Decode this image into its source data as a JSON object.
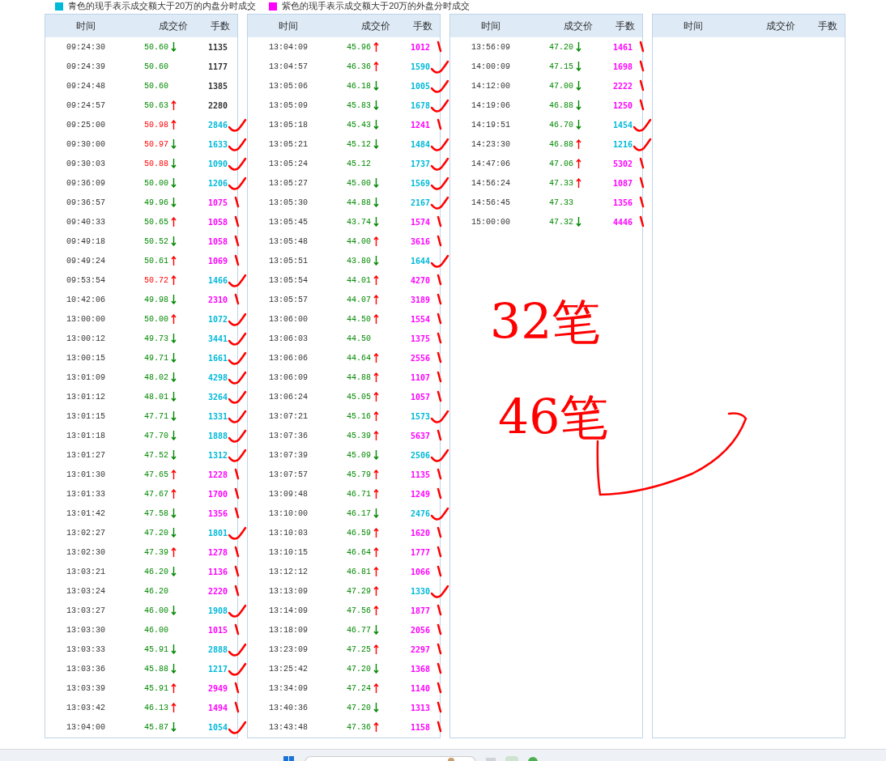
{
  "legend": [
    {
      "color": "#00b9d9",
      "text": "青色的现手表示成交额大于20万的内盘分时成交"
    },
    {
      "color": "#ff00ff",
      "text": "紫色的现手表示成交额大于20万的外盘分时成交"
    }
  ],
  "tables": [
    {
      "columns": [
        "时间",
        "成交价",
        "手数"
      ],
      "rows": [
        {
          "time": "09:24:30",
          "price": "50.60",
          "price_up": false,
          "kind": "down",
          "volume": "1135",
          "color": "#333333"
        },
        {
          "time": "09:24:39",
          "price": "50.60",
          "price_up": false,
          "kind": "none",
          "volume": "1177",
          "color": "#333333"
        },
        {
          "time": "09:24:48",
          "price": "50.60",
          "price_up": false,
          "kind": "none",
          "volume": "1385",
          "color": "#333333"
        },
        {
          "time": "09:24:57",
          "price": "50.63",
          "price_up": false,
          "kind": "up",
          "volume": "2280",
          "color": "#333333"
        },
        {
          "time": "09:25:00",
          "price": "50.98",
          "price_up": true,
          "kind": "up",
          "volume": "2846",
          "color": "#00b9d9"
        },
        {
          "time": "09:30:00",
          "price": "50.97",
          "price_up": true,
          "kind": "down",
          "volume": "1633",
          "color": "#00b9d9"
        },
        {
          "time": "09:30:03",
          "price": "50.88",
          "price_up": true,
          "kind": "down",
          "volume": "1090",
          "color": "#00b9d9"
        },
        {
          "time": "09:36:09",
          "price": "50.00",
          "price_up": false,
          "kind": "down",
          "volume": "1206",
          "color": "#00b9d9"
        },
        {
          "time": "09:36:57",
          "price": "49.96",
          "price_up": false,
          "kind": "down",
          "volume": "1075",
          "color": "#ff00ff"
        },
        {
          "time": "09:40:33",
          "price": "50.65",
          "price_up": false,
          "kind": "up",
          "volume": "1058",
          "color": "#ff00ff"
        },
        {
          "time": "09:49:18",
          "price": "50.52",
          "price_up": false,
          "kind": "down",
          "volume": "1058",
          "color": "#ff00ff"
        },
        {
          "time": "09:49:24",
          "price": "50.61",
          "price_up": false,
          "kind": "up",
          "volume": "1069",
          "color": "#ff00ff"
        },
        {
          "time": "09:53:54",
          "price": "50.72",
          "price_up": true,
          "kind": "up",
          "volume": "1466",
          "color": "#00b9d9"
        },
        {
          "time": "10:42:06",
          "price": "49.98",
          "price_up": false,
          "kind": "down",
          "volume": "2310",
          "color": "#ff00ff"
        },
        {
          "time": "13:00:00",
          "price": "50.00",
          "price_up": false,
          "kind": "up",
          "volume": "1072",
          "color": "#00b9d9"
        },
        {
          "time": "13:00:12",
          "price": "49.73",
          "price_up": false,
          "kind": "down",
          "volume": "3441",
          "color": "#00b9d9"
        },
        {
          "time": "13:00:15",
          "price": "49.71",
          "price_up": false,
          "kind": "down",
          "volume": "1661",
          "color": "#00b9d9"
        },
        {
          "time": "13:01:09",
          "price": "48.02",
          "price_up": false,
          "kind": "down",
          "volume": "4298",
          "color": "#00b9d9"
        },
        {
          "time": "13:01:12",
          "price": "48.01",
          "price_up": false,
          "kind": "down",
          "volume": "3264",
          "color": "#00b9d9"
        },
        {
          "time": "13:01:15",
          "price": "47.71",
          "price_up": false,
          "kind": "down",
          "volume": "1331",
          "color": "#00b9d9"
        },
        {
          "time": "13:01:18",
          "price": "47.70",
          "price_up": false,
          "kind": "down",
          "volume": "1888",
          "color": "#00b9d9"
        },
        {
          "time": "13:01:27",
          "price": "47.52",
          "price_up": false,
          "kind": "down",
          "volume": "1312",
          "color": "#00b9d9"
        },
        {
          "time": "13:01:30",
          "price": "47.65",
          "price_up": false,
          "kind": "up",
          "volume": "1228",
          "color": "#ff00ff"
        },
        {
          "time": "13:01:33",
          "price": "47.67",
          "price_up": false,
          "kind": "up",
          "volume": "1700",
          "color": "#ff00ff"
        },
        {
          "time": "13:01:42",
          "price": "47.58",
          "price_up": false,
          "kind": "down",
          "volume": "1356",
          "color": "#ff00ff"
        },
        {
          "time": "13:02:27",
          "price": "47.20",
          "price_up": false,
          "kind": "down",
          "volume": "1801",
          "color": "#00b9d9"
        },
        {
          "time": "13:02:30",
          "price": "47.39",
          "price_up": false,
          "kind": "up",
          "volume": "1278",
          "color": "#ff00ff"
        },
        {
          "time": "13:03:21",
          "price": "46.20",
          "price_up": false,
          "kind": "down",
          "volume": "1136",
          "color": "#ff00ff"
        },
        {
          "time": "13:03:24",
          "price": "46.20",
          "price_up": false,
          "kind": "none",
          "volume": "2220",
          "color": "#ff00ff"
        },
        {
          "time": "13:03:27",
          "price": "46.00",
          "price_up": false,
          "kind": "down",
          "volume": "1908",
          "color": "#00b9d9"
        },
        {
          "time": "13:03:30",
          "price": "46.00",
          "price_up": false,
          "kind": "none",
          "volume": "1015",
          "color": "#ff00ff"
        },
        {
          "time": "13:03:33",
          "price": "45.91",
          "price_up": false,
          "kind": "down",
          "volume": "2888",
          "color": "#00b9d9"
        },
        {
          "time": "13:03:36",
          "price": "45.88",
          "price_up": false,
          "kind": "down",
          "volume": "1217",
          "color": "#00b9d9"
        },
        {
          "time": "13:03:39",
          "price": "45.91",
          "price_up": false,
          "kind": "up",
          "volume": "2949",
          "color": "#ff00ff"
        },
        {
          "time": "13:03:42",
          "price": "46.13",
          "price_up": false,
          "kind": "up",
          "volume": "1494",
          "color": "#ff00ff"
        },
        {
          "time": "13:04:00",
          "price": "45.87",
          "price_up": false,
          "kind": "down",
          "volume": "1054",
          "color": "#00b9d9"
        }
      ]
    },
    {
      "columns": [
        "时间",
        "成交价",
        "手数"
      ],
      "rows": [
        {
          "time": "13:04:09",
          "price": "45.96",
          "price_up": false,
          "kind": "up",
          "volume": "1012",
          "color": "#ff00ff"
        },
        {
          "time": "13:04:57",
          "price": "46.36",
          "price_up": false,
          "kind": "up",
          "volume": "1590",
          "color": "#00b9d9"
        },
        {
          "time": "13:05:06",
          "price": "46.18",
          "price_up": false,
          "kind": "down",
          "volume": "1005",
          "color": "#00b9d9"
        },
        {
          "time": "13:05:09",
          "price": "45.83",
          "price_up": false,
          "kind": "down",
          "volume": "1678",
          "color": "#00b9d9"
        },
        {
          "time": "13:05:18",
          "price": "45.43",
          "price_up": false,
          "kind": "down",
          "volume": "1241",
          "color": "#ff00ff"
        },
        {
          "time": "13:05:21",
          "price": "45.12",
          "price_up": false,
          "kind": "down",
          "volume": "1484",
          "color": "#00b9d9"
        },
        {
          "time": "13:05:24",
          "price": "45.12",
          "price_up": false,
          "kind": "none",
          "volume": "1737",
          "color": "#00b9d9"
        },
        {
          "time": "13:05:27",
          "price": "45.00",
          "price_up": false,
          "kind": "down",
          "volume": "1569",
          "color": "#00b9d9"
        },
        {
          "time": "13:05:30",
          "price": "44.88",
          "price_up": false,
          "kind": "down",
          "volume": "2167",
          "color": "#00b9d9"
        },
        {
          "time": "13:05:45",
          "price": "43.74",
          "price_up": false,
          "kind": "down",
          "volume": "1574",
          "color": "#ff00ff"
        },
        {
          "time": "13:05:48",
          "price": "44.00",
          "price_up": false,
          "kind": "up",
          "volume": "3616",
          "color": "#ff00ff"
        },
        {
          "time": "13:05:51",
          "price": "43.80",
          "price_up": false,
          "kind": "down",
          "volume": "1644",
          "color": "#00b9d9"
        },
        {
          "time": "13:05:54",
          "price": "44.01",
          "price_up": false,
          "kind": "up",
          "volume": "4270",
          "color": "#ff00ff"
        },
        {
          "time": "13:05:57",
          "price": "44.07",
          "price_up": false,
          "kind": "up",
          "volume": "3189",
          "color": "#ff00ff"
        },
        {
          "time": "13:06:00",
          "price": "44.50",
          "price_up": false,
          "kind": "up",
          "volume": "1554",
          "color": "#ff00ff"
        },
        {
          "time": "13:06:03",
          "price": "44.50",
          "price_up": false,
          "kind": "none",
          "volume": "1375",
          "color": "#ff00ff"
        },
        {
          "time": "13:06:06",
          "price": "44.64",
          "price_up": false,
          "kind": "up",
          "volume": "2556",
          "color": "#ff00ff"
        },
        {
          "time": "13:06:09",
          "price": "44.88",
          "price_up": false,
          "kind": "up",
          "volume": "1107",
          "color": "#ff00ff"
        },
        {
          "time": "13:06:24",
          "price": "45.05",
          "price_up": false,
          "kind": "up",
          "volume": "1057",
          "color": "#ff00ff"
        },
        {
          "time": "13:07:21",
          "price": "45.16",
          "price_up": false,
          "kind": "up",
          "volume": "1573",
          "color": "#00b9d9"
        },
        {
          "time": "13:07:36",
          "price": "45.39",
          "price_up": false,
          "kind": "up",
          "volume": "5637",
          "color": "#ff00ff"
        },
        {
          "time": "13:07:39",
          "price": "45.09",
          "price_up": false,
          "kind": "down",
          "volume": "2506",
          "color": "#00b9d9"
        },
        {
          "time": "13:07:57",
          "price": "45.79",
          "price_up": false,
          "kind": "up",
          "volume": "1135",
          "color": "#ff00ff"
        },
        {
          "time": "13:09:48",
          "price": "46.71",
          "price_up": false,
          "kind": "up",
          "volume": "1249",
          "color": "#ff00ff"
        },
        {
          "time": "13:10:00",
          "price": "46.17",
          "price_up": false,
          "kind": "down",
          "volume": "2476",
          "color": "#00b9d9"
        },
        {
          "time": "13:10:03",
          "price": "46.59",
          "price_up": false,
          "kind": "up",
          "volume": "1620",
          "color": "#ff00ff"
        },
        {
          "time": "13:10:15",
          "price": "46.64",
          "price_up": false,
          "kind": "up",
          "volume": "1777",
          "color": "#ff00ff"
        },
        {
          "time": "13:12:12",
          "price": "46.81",
          "price_up": false,
          "kind": "up",
          "volume": "1066",
          "color": "#ff00ff"
        },
        {
          "time": "13:13:09",
          "price": "47.29",
          "price_up": false,
          "kind": "up",
          "volume": "1330",
          "color": "#00b9d9"
        },
        {
          "time": "13:14:09",
          "price": "47.56",
          "price_up": false,
          "kind": "up",
          "volume": "1877",
          "color": "#ff00ff"
        },
        {
          "time": "13:18:09",
          "price": "46.77",
          "price_up": false,
          "kind": "down",
          "volume": "2056",
          "color": "#ff00ff"
        },
        {
          "time": "13:23:09",
          "price": "47.25",
          "price_up": false,
          "kind": "up",
          "volume": "2297",
          "color": "#ff00ff"
        },
        {
          "time": "13:25:42",
          "price": "47.20",
          "price_up": false,
          "kind": "down",
          "volume": "1368",
          "color": "#ff00ff"
        },
        {
          "time": "13:34:09",
          "price": "47.24",
          "price_up": false,
          "kind": "up",
          "volume": "1140",
          "color": "#ff00ff"
        },
        {
          "time": "13:40:36",
          "price": "47.20",
          "price_up": false,
          "kind": "down",
          "volume": "1313",
          "color": "#ff00ff"
        },
        {
          "time": "13:43:48",
          "price": "47.36",
          "price_up": false,
          "kind": "up",
          "volume": "1158",
          "color": "#ff00ff"
        }
      ]
    },
    {
      "columns": [
        "时间",
        "成交价",
        "手数"
      ],
      "rows": [
        {
          "time": "13:56:09",
          "price": "47.20",
          "price_up": false,
          "kind": "down",
          "volume": "1461",
          "color": "#ff00ff"
        },
        {
          "time": "14:00:09",
          "price": "47.15",
          "price_up": false,
          "kind": "down",
          "volume": "1698",
          "color": "#ff00ff"
        },
        {
          "time": "14:12:00",
          "price": "47.00",
          "price_up": false,
          "kind": "down",
          "volume": "2222",
          "color": "#ff00ff"
        },
        {
          "time": "14:19:06",
          "price": "46.88",
          "price_up": false,
          "kind": "down",
          "volume": "1250",
          "color": "#ff00ff"
        },
        {
          "time": "14:19:51",
          "price": "46.70",
          "price_up": false,
          "kind": "down",
          "volume": "1454",
          "color": "#00b9d9"
        },
        {
          "time": "14:23:30",
          "price": "46.88",
          "price_up": false,
          "kind": "up",
          "volume": "1216",
          "color": "#00b9d9"
        },
        {
          "time": "14:47:06",
          "price": "47.06",
          "price_up": false,
          "kind": "up",
          "volume": "5302",
          "color": "#ff00ff"
        },
        {
          "time": "14:56:24",
          "price": "47.33",
          "price_up": false,
          "kind": "up",
          "volume": "1087",
          "color": "#ff00ff"
        },
        {
          "time": "14:56:45",
          "price": "47.33",
          "price_up": false,
          "kind": "none",
          "volume": "1356",
          "color": "#ff00ff"
        },
        {
          "time": "15:00:00",
          "price": "47.32",
          "price_up": false,
          "kind": "down",
          "volume": "4446",
          "color": "#ff00ff"
        }
      ]
    },
    {
      "columns": [
        "时间",
        "成交价",
        "手数"
      ]
    }
  ],
  "handwritten_notes": [
    "32笔",
    "46笔"
  ]
}
